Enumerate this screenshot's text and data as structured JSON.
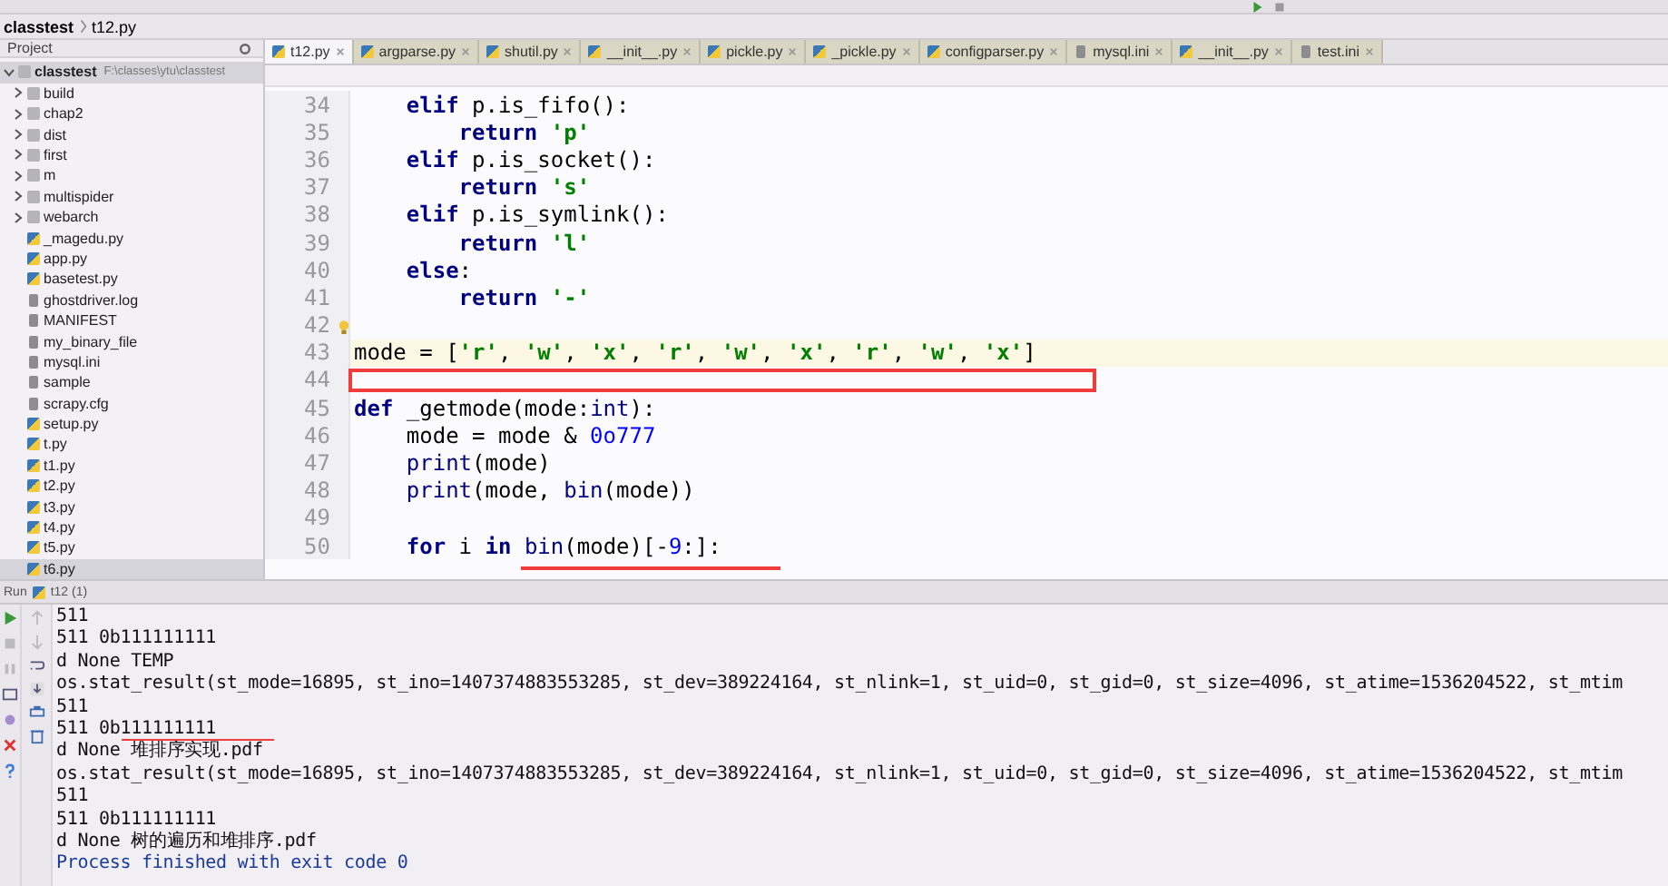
{
  "breadcrumb": [
    "classtest",
    "t12.py"
  ],
  "project_panel": {
    "title": "Project",
    "tree": [
      {
        "name": "classtest",
        "path": "F:\\classes\\ytu\\classtest",
        "kind": "folder",
        "expanded": true,
        "selected": true,
        "children": [
          {
            "name": "build",
            "kind": "folder",
            "expanded": false,
            "selected": false
          },
          {
            "name": "chap2",
            "kind": "folder",
            "expanded": false,
            "selected": false
          },
          {
            "name": "dist",
            "kind": "folder",
            "expanded": false,
            "selected": false
          },
          {
            "name": "first",
            "kind": "folder",
            "expanded": false,
            "selected": false
          },
          {
            "name": "m",
            "kind": "folder",
            "expanded": false,
            "selected": false
          },
          {
            "name": "multispider",
            "kind": "folder",
            "expanded": false,
            "selected": false
          },
          {
            "name": "webarch",
            "kind": "folder",
            "expanded": false,
            "selected": false
          },
          {
            "name": "_magedu.py",
            "kind": "python",
            "selected": false
          },
          {
            "name": "app.py",
            "kind": "python",
            "selected": false
          },
          {
            "name": "basetest.py",
            "kind": "python",
            "selected": false
          },
          {
            "name": "ghostdriver.log",
            "kind": "file",
            "selected": false
          },
          {
            "name": "MANIFEST",
            "kind": "file",
            "selected": false
          },
          {
            "name": "my_binary_file",
            "kind": "file",
            "selected": false
          },
          {
            "name": "mysql.ini",
            "kind": "file",
            "selected": false
          },
          {
            "name": "sample",
            "kind": "file",
            "selected": false
          },
          {
            "name": "scrapy.cfg",
            "kind": "file",
            "selected": false
          },
          {
            "name": "setup.py",
            "kind": "python",
            "selected": false
          },
          {
            "name": "t.py",
            "kind": "python",
            "selected": false
          },
          {
            "name": "t1.py",
            "kind": "python",
            "selected": false
          },
          {
            "name": "t2.py",
            "kind": "python",
            "selected": false
          },
          {
            "name": "t3.py",
            "kind": "python",
            "selected": false
          },
          {
            "name": "t4.py",
            "kind": "python",
            "selected": false
          },
          {
            "name": "t5.py",
            "kind": "python",
            "selected": false
          },
          {
            "name": "t6.py",
            "kind": "python",
            "selected": true
          }
        ]
      }
    ]
  },
  "editor": {
    "tabs": [
      {
        "label": "t12.py",
        "kind": "python",
        "selected": true
      },
      {
        "label": "argparse.py",
        "kind": "python",
        "selected": false
      },
      {
        "label": "shutil.py",
        "kind": "python",
        "selected": false
      },
      {
        "label": "__init__.py",
        "kind": "python",
        "selected": false
      },
      {
        "label": "pickle.py",
        "kind": "python",
        "selected": false
      },
      {
        "label": "_pickle.py",
        "kind": "python",
        "selected": false
      },
      {
        "label": "configparser.py",
        "kind": "python",
        "selected": false
      },
      {
        "label": "mysql.ini",
        "kind": "file",
        "selected": false
      },
      {
        "label": "__init__.py",
        "kind": "python",
        "selected": false
      },
      {
        "label": "test.ini",
        "kind": "file",
        "selected": false
      }
    ],
    "lines": [
      {
        "number": "34",
        "current": false,
        "tokens": [
          {
            "kind": "keyword",
            "text": "    elif"
          },
          {
            "kind": "plain",
            "text": " p.is_fifo():"
          }
        ]
      },
      {
        "number": "35",
        "current": false,
        "tokens": [
          {
            "kind": "keyword",
            "text": "        return "
          },
          {
            "kind": "string",
            "text": "'p'"
          }
        ]
      },
      {
        "number": "36",
        "current": false,
        "tokens": [
          {
            "kind": "keyword",
            "text": "    elif"
          },
          {
            "kind": "plain",
            "text": " p.is_socket():"
          }
        ]
      },
      {
        "number": "37",
        "current": false,
        "tokens": [
          {
            "kind": "keyword",
            "text": "        return "
          },
          {
            "kind": "string",
            "text": "'s'"
          }
        ]
      },
      {
        "number": "38",
        "current": false,
        "tokens": [
          {
            "kind": "keyword",
            "text": "    elif"
          },
          {
            "kind": "plain",
            "text": " p.is_symlink():"
          }
        ]
      },
      {
        "number": "39",
        "current": false,
        "tokens": [
          {
            "kind": "keyword",
            "text": "        return "
          },
          {
            "kind": "string",
            "text": "'l'"
          }
        ]
      },
      {
        "number": "40",
        "current": false,
        "tokens": [
          {
            "kind": "keyword",
            "text": "    else"
          },
          {
            "kind": "plain",
            "text": ":"
          }
        ]
      },
      {
        "number": "41",
        "current": false,
        "tokens": [
          {
            "kind": "keyword",
            "text": "        return "
          },
          {
            "kind": "string",
            "text": "'-'"
          }
        ]
      },
      {
        "number": "42",
        "current": false
      },
      {
        "number": "43",
        "current": true,
        "tokens": [
          {
            "kind": "plain",
            "text": "mode = ["
          },
          {
            "kind": "string",
            "text": "'r'"
          },
          {
            "kind": "plain",
            "text": ", "
          },
          {
            "kind": "string",
            "text": "'w'"
          },
          {
            "kind": "plain",
            "text": ", "
          },
          {
            "kind": "string",
            "text": "'x'"
          },
          {
            "kind": "plain",
            "text": ", "
          },
          {
            "kind": "string",
            "text": "'r'"
          },
          {
            "kind": "plain",
            "text": ", "
          },
          {
            "kind": "string",
            "text": "'w'"
          },
          {
            "kind": "plain",
            "text": ", "
          },
          {
            "kind": "string",
            "text": "'x'"
          },
          {
            "kind": "plain",
            "text": ", "
          },
          {
            "kind": "string",
            "text": "'r'"
          },
          {
            "kind": "plain",
            "text": ", "
          },
          {
            "kind": "string",
            "text": "'w'"
          },
          {
            "kind": "plain",
            "text": ", "
          },
          {
            "kind": "string",
            "text": "'x'"
          },
          {
            "kind": "plain",
            "text": "]"
          }
        ]
      },
      {
        "number": "44",
        "current": false
      },
      {
        "number": "45",
        "current": false,
        "tokens": [
          {
            "kind": "keyword",
            "text": "def"
          },
          {
            "kind": "plain",
            "text": " _getmode(mode:"
          },
          {
            "kind": "builtin",
            "text": "int"
          },
          {
            "kind": "plain",
            "text": "):"
          }
        ]
      },
      {
        "number": "46",
        "current": false,
        "tokens": [
          {
            "kind": "plain",
            "text": "    mode = mode & "
          },
          {
            "kind": "number",
            "text": "0o777"
          }
        ]
      },
      {
        "number": "47",
        "current": false,
        "tokens": [
          {
            "kind": "builtin",
            "text": "    print"
          },
          {
            "kind": "plain",
            "text": "(mode)"
          }
        ]
      },
      {
        "number": "48",
        "current": false,
        "tokens": [
          {
            "kind": "builtin",
            "text": "    print"
          },
          {
            "kind": "plain",
            "text": "(mode, "
          },
          {
            "kind": "builtin",
            "text": "bin"
          },
          {
            "kind": "plain",
            "text": "(mode))"
          }
        ]
      },
      {
        "number": "49",
        "current": false
      },
      {
        "number": "50",
        "current": false,
        "tokens": [
          {
            "kind": "keyword",
            "text": "    for"
          },
          {
            "kind": "plain",
            "text": " i "
          },
          {
            "kind": "keyword",
            "text": "in "
          },
          {
            "kind": "builtin",
            "text": "bin"
          },
          {
            "kind": "plain",
            "text": "(mode)[-"
          },
          {
            "kind": "number",
            "text": "9"
          },
          {
            "kind": "plain",
            "text": ":]:"
          }
        ]
      }
    ]
  },
  "run_panel": {
    "title": "Run",
    "config": "t12 (1)",
    "output": [
      {
        "kind": "stdout",
        "text": "511"
      },
      {
        "kind": "stdout",
        "text": "511 0b111111111"
      },
      {
        "kind": "stdout",
        "text": "d None TEMP"
      },
      {
        "kind": "stdout",
        "text": "os.stat_result(st_mode=16895, st_ino=1407374883553285, st_dev=389224164, st_nlink=1, st_uid=0, st_gid=0, st_size=4096, st_atime=1536204522, st_mtim"
      },
      {
        "kind": "stdout",
        "text": "511"
      },
      {
        "kind": "stdout",
        "text": "511 0b111111111"
      },
      {
        "kind": "stdout",
        "text": "d None 堆排序实现.pdf"
      },
      {
        "kind": "stdout",
        "text": "os.stat_result(st_mode=16895, st_ino=1407374883553285, st_dev=389224164, st_nlink=1, st_uid=0, st_gid=0, st_size=4096, st_atime=1536204522, st_mtim"
      },
      {
        "kind": "stdout",
        "text": "511"
      },
      {
        "kind": "stdout",
        "text": "511 0b111111111"
      },
      {
        "kind": "stdout",
        "text": "d None 树的遍历和堆排序.pdf"
      },
      {
        "kind": "system",
        "text": "Process finished with exit code 0"
      }
    ]
  }
}
